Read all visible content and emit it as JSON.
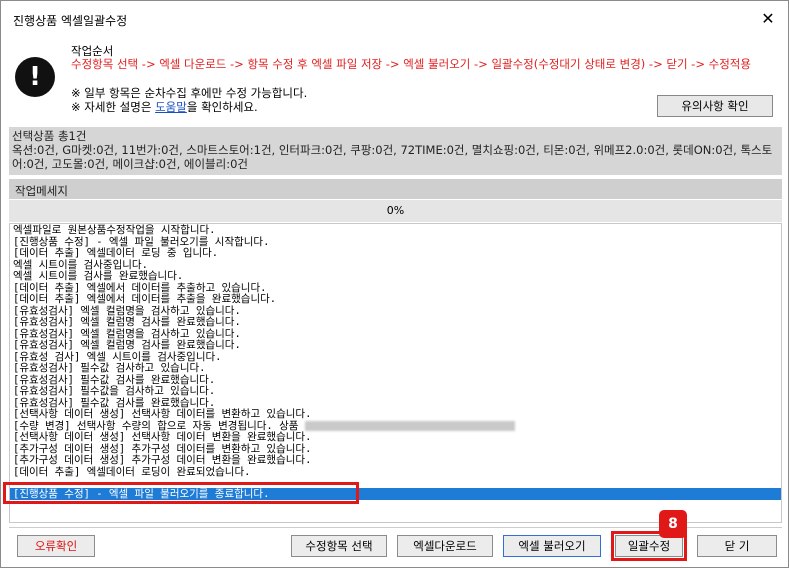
{
  "window": {
    "title": "진행상품 엑셀일괄수정",
    "close_glyph": "✕"
  },
  "order": {
    "label": "작업순서",
    "steps": "수정항목 선택 -> 엑셀 다운로드 -> 항목 수정 후 엑셀 파일 저장 -> 엑셀 불러오기 -> 일괄수정(수정대기 상태로 변경) -> 닫기 -> 수정적용",
    "note1": "※ 일부 항목은 순차수집 후에만 수정 가능합니다.",
    "note2_prefix": "※ 자세한 설명은 ",
    "note2_link": "도움말",
    "note2_suffix": "을 확인하세요.",
    "notice_button": "유의사항 확인",
    "icon": "exclamation-icon"
  },
  "selection": {
    "count_text": "선택상품 총1건",
    "markets_text": "옥션:0건, G마켓:0건, 11번가:0건, 스마트스토어:1건, 인터파크:0건, 쿠팡:0건, 72TIME:0건, 멸치쇼핑:0건, 티몬:0건, 위메프2.0:0건, 롯데ON:0건, 톡스토어:0건, 고도몰:0건, 메이크샵:0건, 에이블리:0건"
  },
  "messages": {
    "header": "작업메세지",
    "progress": "0%",
    "lines": [
      "엑셀파일로 원본상품수정작업을 시작합니다.",
      "[진행상품 수정] - 엑셀 파일 불러오기를 시작합니다.",
      "[데이터 추출] 엑셀데이터 로딩 중 입니다.",
      "엑셀 시트이를 검사중입니다.",
      "엑셀 시트이를 검사를 완료했습니다.",
      "[데이터 추출] 엑셀에서 데이터를 추출하고 있습니다.",
      "[데이터 추출] 엑셀에서 데이터를 추출을 완료했습니다.",
      "[유효성검사] 엑셀 컬럼명을 검사하고 있습니다.",
      "[유효성검사] 엑셀 컬럼명 검사를 완료했습니다.",
      "[유효성검사] 엑셀 컬럼명을 검사하고 있습니다.",
      "[유효성검사] 엑셀 컬럼명 검사를 완료했습니다.",
      "[유효성 검사] 엑셀 시트이를 검사중입니다.",
      "[유효성검사] 필수값 검사하고 있습니다.",
      "[유효성검사] 필수값 검사를 완료했습니다.",
      "[유효성검사] 필수값을 검사하고 있습니다.",
      "[유효성검사] 필수값 검사를 완료했습니다.",
      "[선택사항 데이터 생성] 선택사항 데이터를 변환하고 있습니다.",
      "[수량 변경] 선택사항 수량의 합으로 자동 변경됩니다. 상품",
      "[선택사항 데이터 생성] 선택사항 데이터 변환을 완료했습니다.",
      "[추가구성 데이터 생성] 추가구성 데이터를 변환하고 있습니다.",
      "[추가구성 데이터 생성] 추가구성 데이터 변환을 완료했습니다.",
      "[데이터 추출] 엑셀데이터 로딩이 완료되었습니다."
    ],
    "selected_line": "[진행상품 수정] - 엑셀 파일 불러오기를 종료합니다."
  },
  "buttons": {
    "error_check": "오류확인",
    "select_items": "수정항목 선택",
    "excel_download": "엑셀다운로드",
    "excel_load": "엑셀 불러오기",
    "bulk_edit": "일괄수정",
    "close": "닫 기"
  },
  "step_badge": "8",
  "colors": {
    "accent_red": "#e01818",
    "selection_blue": "#1e7bd6",
    "link_blue": "#1a4fc4"
  }
}
